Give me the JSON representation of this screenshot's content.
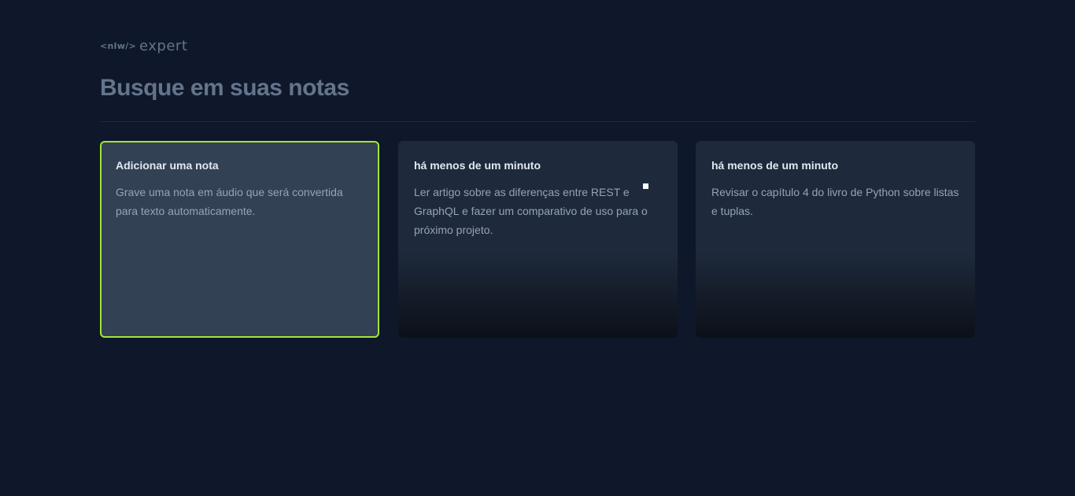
{
  "logo": {
    "nlw": "<nlw/>",
    "expert": "expert"
  },
  "search": {
    "placeholder": "Busque em suas notas"
  },
  "add_card": {
    "title": "Adicionar uma nota",
    "description": "Grave uma nota em áudio que será convertida para texto automaticamente."
  },
  "notes": [
    {
      "date": "há menos de um minuto",
      "content": "Ler artigo sobre as diferenças entre REST e GraphQL e fazer um comparativo de uso para o próximo projeto."
    },
    {
      "date": "há menos de um minuto",
      "content": "Revisar o capítulo 4 do livro de Python sobre listas e tuplas."
    }
  ],
  "colors": {
    "background": "#0f172a",
    "card": "#1e293b",
    "add_card": "#334155",
    "accent": "#a3e635",
    "muted_text": "#64748b"
  }
}
